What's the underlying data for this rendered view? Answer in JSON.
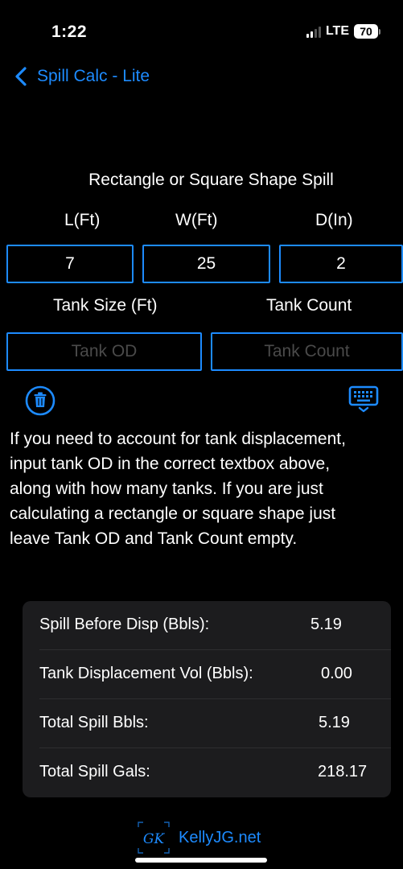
{
  "status_bar": {
    "time": "1:22",
    "network": "LTE",
    "battery": "70"
  },
  "nav": {
    "back_label": "Spill Calc - Lite"
  },
  "form": {
    "title": "Rectangle or Square Shape Spill",
    "length_label": "L(Ft)",
    "width_label": "W(Ft)",
    "depth_label": "D(In)",
    "length_value": "7",
    "width_value": "25",
    "depth_value": "2",
    "tank_size_label": "Tank Size (Ft)",
    "tank_count_label": "Tank Count",
    "tank_od_placeholder": "Tank OD",
    "tank_count_placeholder": "Tank Count"
  },
  "icons": {
    "clear": "trash-icon",
    "keyboard": "keyboard-dismiss-icon"
  },
  "info": {
    "lines": [
      "If you need to account for tank displacement,",
      "input tank OD in the correct textbox above,",
      "along with how many tanks.  If you are just",
      "calculating a rectangle or square shape just",
      "leave Tank OD and Tank Count empty."
    ]
  },
  "results": [
    {
      "label": "Spill Before Disp (Bbls):",
      "value": "5.19"
    },
    {
      "label": "Tank Displacement Vol (Bbls):",
      "value": "0.00"
    },
    {
      "label": "Total Spill Bbls:",
      "value": "5.19"
    },
    {
      "label": "Total Spill Gals:",
      "value": "218.17"
    }
  ],
  "footer": {
    "logo_text": "GK",
    "site": "KellyJG.net"
  },
  "colors": {
    "accent": "#1d8bff",
    "background": "#000000",
    "card": "#1c1c1e"
  }
}
